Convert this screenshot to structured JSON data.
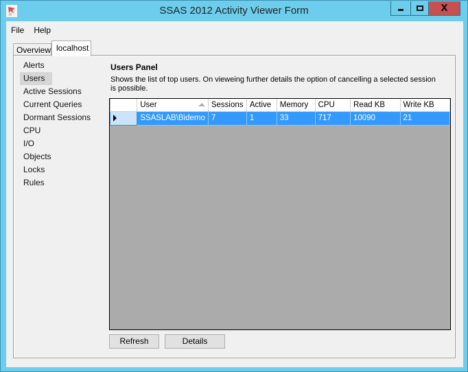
{
  "window": {
    "title": "SSAS 2012 Activity Viewer Form",
    "controls": {
      "minimize": "minimize",
      "maximize": "maximize",
      "close": "X"
    },
    "colors": {
      "frame": "#6dcdec",
      "close": "#c75050",
      "selection": "#3399ff"
    }
  },
  "menu": {
    "items": [
      {
        "label": "File"
      },
      {
        "label": "Help"
      }
    ]
  },
  "tabs": [
    {
      "label": "Overview",
      "active": false
    },
    {
      "label": "localhost",
      "active": true
    }
  ],
  "nav": {
    "selected": "Users",
    "items": [
      {
        "label": "Alerts"
      },
      {
        "label": "Users"
      },
      {
        "label": "Active Sessions"
      },
      {
        "label": "Current Queries"
      },
      {
        "label": "Dormant Sessions"
      },
      {
        "label": "CPU"
      },
      {
        "label": "I/O"
      },
      {
        "label": "Objects"
      },
      {
        "label": "Locks"
      },
      {
        "label": "Rules"
      }
    ]
  },
  "panel": {
    "title": "Users Panel",
    "description": "Shows the list of top users. On vieweing further details the option of cancelling a selected session is possible."
  },
  "grid": {
    "sort_column": "User",
    "sort_direction": "ascending",
    "columns": [
      "User",
      "Sessions",
      "Active",
      "Memory",
      "CPU",
      "Read KB",
      "Write KB"
    ],
    "rows": [
      {
        "selected": true,
        "cells": [
          "SSASLAB\\Bidemo",
          "7",
          "1",
          "33",
          "717",
          "10090",
          "21"
        ]
      }
    ]
  },
  "buttons": {
    "refresh": "Refresh",
    "details": "Details"
  }
}
